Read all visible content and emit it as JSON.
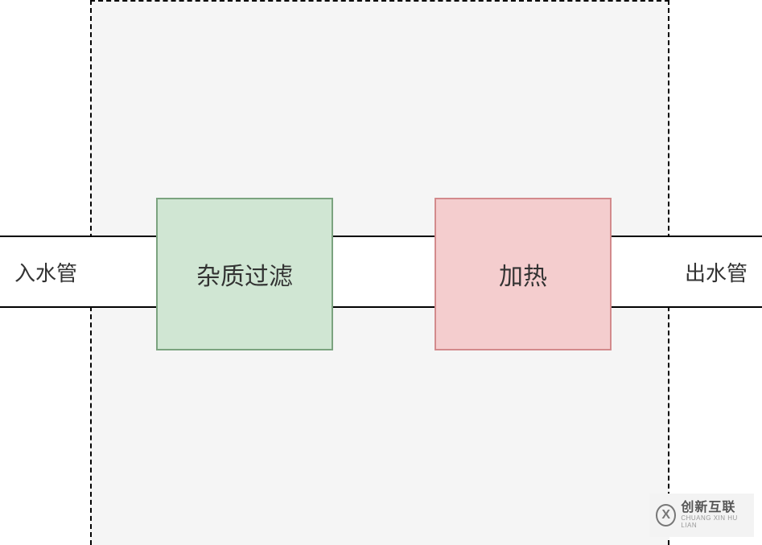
{
  "diagram": {
    "inlet_label": "入水管",
    "outlet_label": "出水管",
    "filter_label": "杂质过滤",
    "heat_label": "加热"
  },
  "colors": {
    "filter_bg": "#d0e6d3",
    "filter_border": "#7ba37f",
    "heat_bg": "#f4cdce",
    "heat_border": "#d38a8c",
    "container_bg": "#f5f5f5"
  },
  "watermark": {
    "icon_text": "X",
    "main": "创新互联",
    "sub": "CHUANG XIN HU LIAN"
  }
}
